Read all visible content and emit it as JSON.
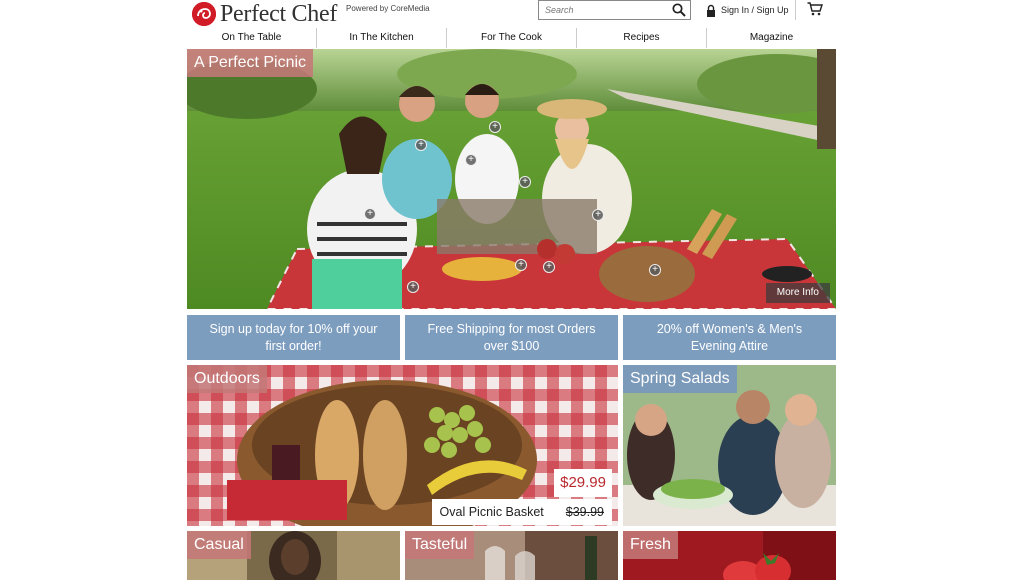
{
  "brand": {
    "name": "Perfect Chef",
    "powered_by": "Powered by CoreMedia"
  },
  "search": {
    "placeholder": "Search"
  },
  "account": {
    "signin_label": "Sign In / Sign Up"
  },
  "icons": {
    "search": "search-icon",
    "lock": "lock-icon",
    "cart": "cart-icon",
    "hotspot": "plus-circle-icon",
    "logo": "chef-logo-icon"
  },
  "nav": {
    "items": [
      "On The Table",
      "In The Kitchen",
      "For The Cook",
      "Recipes",
      "Magazine"
    ]
  },
  "hero": {
    "title": "A Perfect Picnic",
    "more_info": "More Info",
    "hotspot_symbol": "+"
  },
  "promos": [
    "Sign up today for 10% off your first order!",
    "Free Shipping for most Orders over $100",
    "20% off Women's & Men's Evening Attire"
  ],
  "tiles": {
    "outdoors": {
      "title": "Outdoors",
      "price": "$29.99",
      "product_name": "Oval Picnic Basket",
      "old_price": "$39.99"
    },
    "spring_salads": {
      "title": "Spring Salads"
    },
    "casual": {
      "title": "Casual"
    },
    "tasteful": {
      "title": "Tasteful"
    },
    "fresh": {
      "title": "Fresh"
    }
  },
  "colors": {
    "brand_red": "#d11b27",
    "promo_blue": "#7d9dbf",
    "tag_rose": "#c47878",
    "tag_blue": "#7896be",
    "price_red": "#b8282e"
  }
}
